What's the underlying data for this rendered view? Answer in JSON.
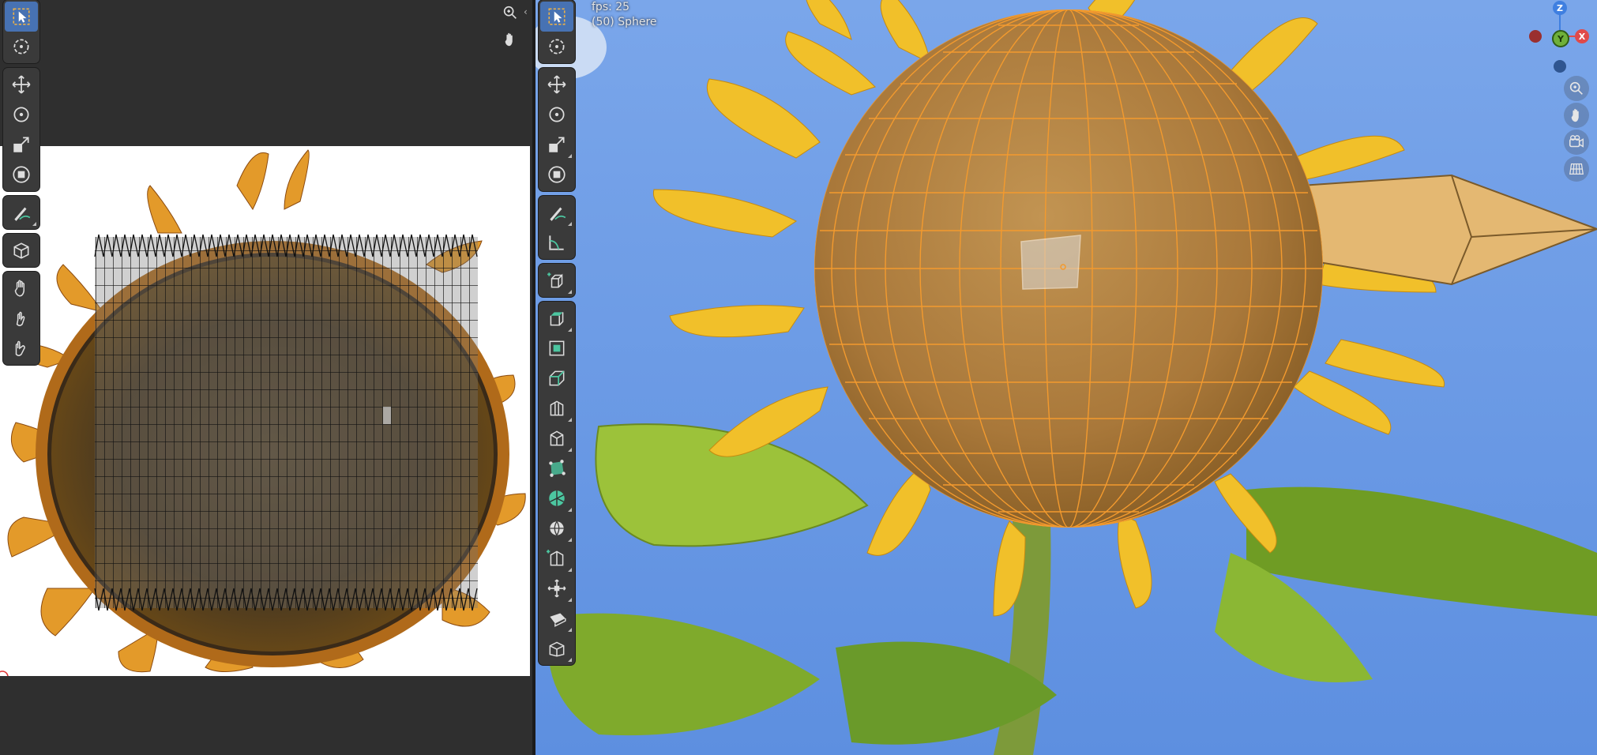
{
  "viewport": {
    "fps_text": "fps: 25",
    "object_text": "(50) Sphere"
  },
  "gizmo": {
    "x_label": "X",
    "y_label": "Y",
    "z_label": "Z"
  },
  "colors": {
    "accent": "#4772b3",
    "mesh_edge": "#f39a2e",
    "sky": "#6f9ee8"
  },
  "uv_tools": [
    "select-box",
    "cursor",
    "move",
    "rotate",
    "scale",
    "transform",
    "annotate",
    "uv-box",
    "grab",
    "relax",
    "pinch"
  ],
  "viewport_tools": [
    "select-box",
    "cursor",
    "move",
    "rotate",
    "scale",
    "transform",
    "annotate",
    "measure",
    "add-cube",
    "extrude",
    "inset",
    "bevel",
    "loop-cut",
    "knife",
    "poly-build",
    "spin",
    "smooth",
    "edge-slide",
    "shrink-fatten",
    "shear",
    "rip"
  ]
}
